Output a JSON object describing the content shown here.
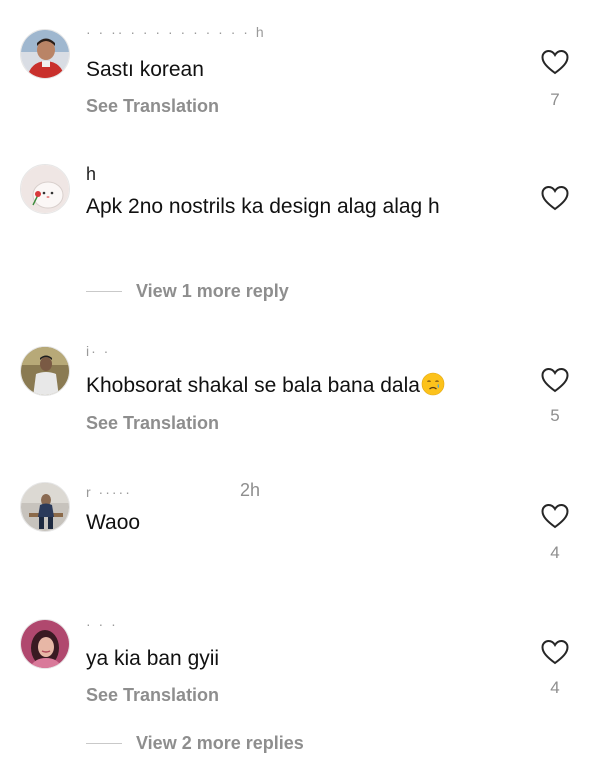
{
  "comments": [
    {
      "username": "· ·       ·· ·      ·   ·  ·  ·  ·  ·   ·   ·  ·  h",
      "time": "",
      "text": "Sastı korean",
      "translate_label": "See Translation",
      "likes": "7",
      "avatar_icon": "profile-photo-man-red-shirt"
    },
    {
      "username": "h",
      "time": "",
      "text": "Apk 2no nostrils ka design alag alag h",
      "translate_label": "",
      "likes": "",
      "avatar_icon": "profile-photo-blob-with-rose",
      "replies_label": "View 1 more reply"
    },
    {
      "username": "i· ·",
      "time": "",
      "text": "Khobsorat shakal se bala bana dala",
      "emoji": "crying-face",
      "translate_label": "See Translation",
      "likes": "5",
      "avatar_icon": "profile-photo-man-outdoors"
    },
    {
      "username": "r ·····",
      "time": "2h",
      "text": "Waoo",
      "translate_label": "",
      "likes": "4",
      "avatar_icon": "profile-photo-man-on-bench"
    },
    {
      "username": "· · ·",
      "time": "",
      "text": "ya kia ban gyii",
      "translate_label": "See Translation",
      "likes": "4",
      "avatar_icon": "profile-photo-woman-pink",
      "replies_label": "View 2 more replies"
    }
  ],
  "colors": {
    "text": "#111111",
    "secondary": "#8e8e8e",
    "divider": "#c9c9c9"
  },
  "icons": {
    "like": "heart-outline-icon"
  }
}
